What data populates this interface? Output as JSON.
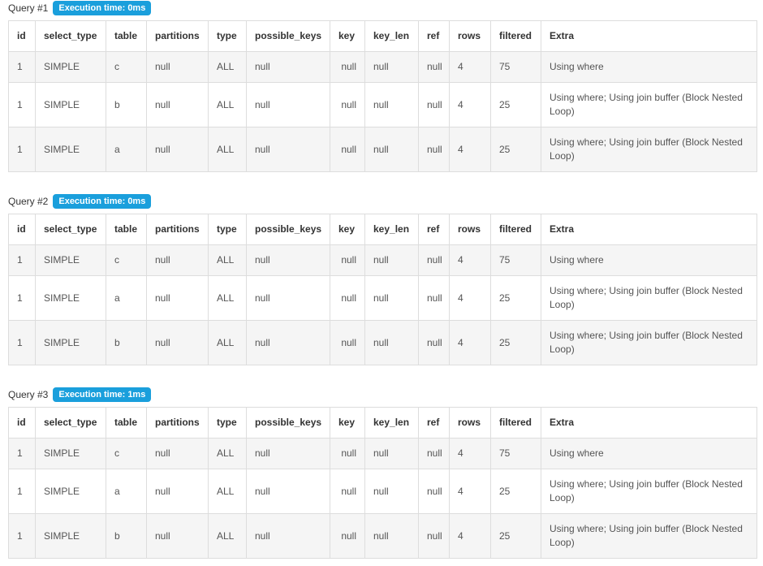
{
  "queries": [
    {
      "label": "Query #1",
      "badge": "Execution time: 0ms",
      "rows": [
        {
          "id": "1",
          "select_type": "SIMPLE",
          "table": "c",
          "partitions": "null",
          "type": "ALL",
          "possible_keys": "null",
          "key": "null",
          "key_len": "null",
          "ref": "null",
          "rows": "4",
          "filtered": "75",
          "extra": "Using where"
        },
        {
          "id": "1",
          "select_type": "SIMPLE",
          "table": "b",
          "partitions": "null",
          "type": "ALL",
          "possible_keys": "null",
          "key": "null",
          "key_len": "null",
          "ref": "null",
          "rows": "4",
          "filtered": "25",
          "extra": "Using where; Using join buffer (Block Nested Loop)"
        },
        {
          "id": "1",
          "select_type": "SIMPLE",
          "table": "a",
          "partitions": "null",
          "type": "ALL",
          "possible_keys": "null",
          "key": "null",
          "key_len": "null",
          "ref": "null",
          "rows": "4",
          "filtered": "25",
          "extra": "Using where; Using join buffer (Block Nested Loop)"
        }
      ]
    },
    {
      "label": "Query #2",
      "badge": "Execution time: 0ms",
      "rows": [
        {
          "id": "1",
          "select_type": "SIMPLE",
          "table": "c",
          "partitions": "null",
          "type": "ALL",
          "possible_keys": "null",
          "key": "null",
          "key_len": "null",
          "ref": "null",
          "rows": "4",
          "filtered": "75",
          "extra": "Using where"
        },
        {
          "id": "1",
          "select_type": "SIMPLE",
          "table": "a",
          "partitions": "null",
          "type": "ALL",
          "possible_keys": "null",
          "key": "null",
          "key_len": "null",
          "ref": "null",
          "rows": "4",
          "filtered": "25",
          "extra": "Using where; Using join buffer (Block Nested Loop)"
        },
        {
          "id": "1",
          "select_type": "SIMPLE",
          "table": "b",
          "partitions": "null",
          "type": "ALL",
          "possible_keys": "null",
          "key": "null",
          "key_len": "null",
          "ref": "null",
          "rows": "4",
          "filtered": "25",
          "extra": "Using where; Using join buffer (Block Nested Loop)"
        }
      ]
    },
    {
      "label": "Query #3",
      "badge": "Execution time: 1ms",
      "rows": [
        {
          "id": "1",
          "select_type": "SIMPLE",
          "table": "c",
          "partitions": "null",
          "type": "ALL",
          "possible_keys": "null",
          "key": "null",
          "key_len": "null",
          "ref": "null",
          "rows": "4",
          "filtered": "75",
          "extra": "Using where"
        },
        {
          "id": "1",
          "select_type": "SIMPLE",
          "table": "a",
          "partitions": "null",
          "type": "ALL",
          "possible_keys": "null",
          "key": "null",
          "key_len": "null",
          "ref": "null",
          "rows": "4",
          "filtered": "25",
          "extra": "Using where; Using join buffer (Block Nested Loop)"
        },
        {
          "id": "1",
          "select_type": "SIMPLE",
          "table": "b",
          "partitions": "null",
          "type": "ALL",
          "possible_keys": "null",
          "key": "null",
          "key_len": "null",
          "ref": "null",
          "rows": "4",
          "filtered": "25",
          "extra": "Using where; Using join buffer (Block Nested Loop)"
        }
      ]
    }
  ],
  "columns": [
    "id",
    "select_type",
    "table",
    "partitions",
    "type",
    "possible_keys",
    "key",
    "key_len",
    "ref",
    "rows",
    "filtered",
    "Extra"
  ],
  "colors": {
    "badge_bg": "#1a9fdc",
    "row_shade": "#f5f5f5",
    "border": "#dddddd"
  }
}
